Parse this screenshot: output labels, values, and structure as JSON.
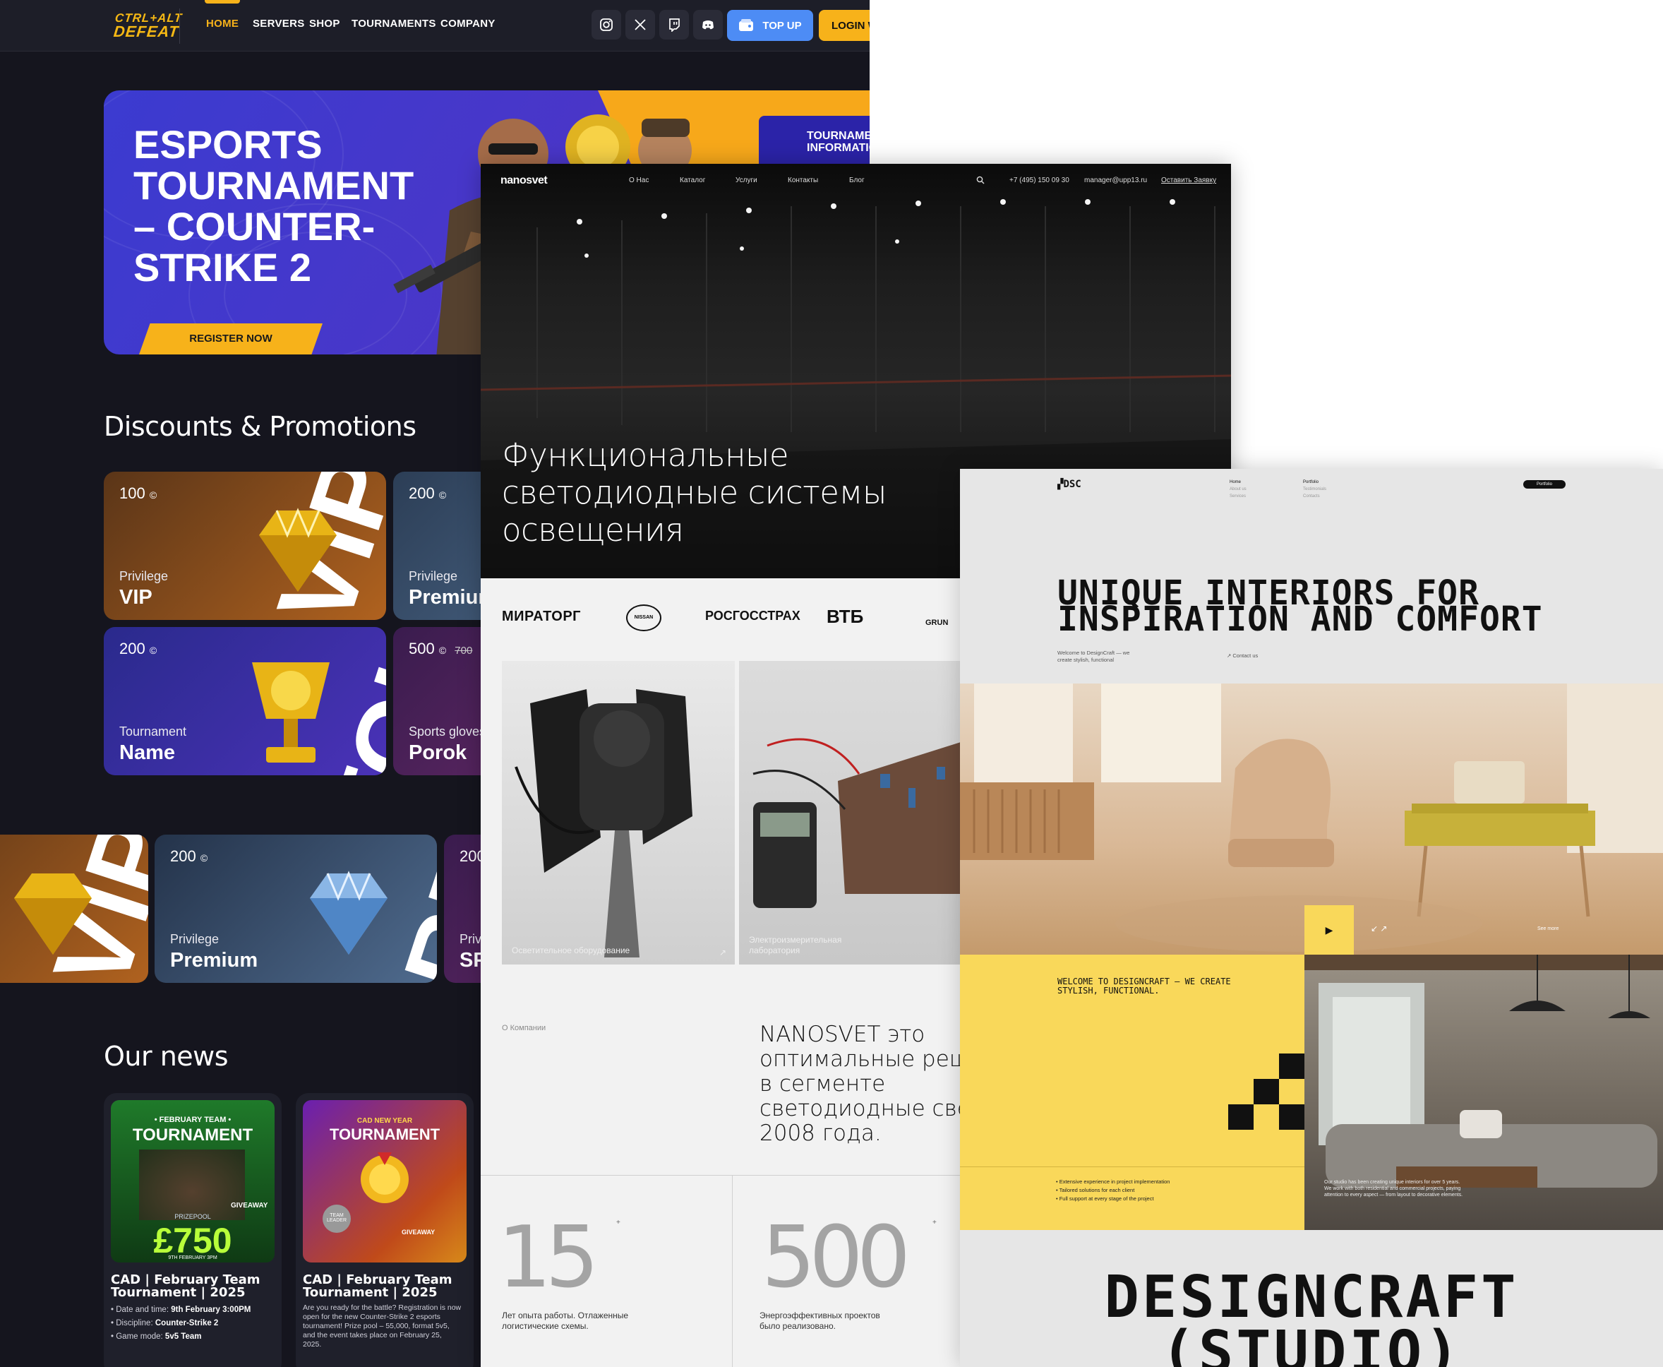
{
  "gaming": {
    "logo": {
      "line1": "CTRL+ALT",
      "line2": "DEFEAT"
    },
    "nav": [
      {
        "label": "HOME",
        "active": true
      },
      {
        "label": "SERVERS"
      },
      {
        "label": "SHOP"
      },
      {
        "label": "TOURNAMENTS"
      },
      {
        "label": "COMPANY"
      }
    ],
    "social_icons": [
      "instagram-icon",
      "x-icon",
      "twitch-icon",
      "discord-icon"
    ],
    "topup_label": "TOP UP",
    "login_label": "LOGIN WITH STEAM",
    "hero": {
      "title": "ESPORTS TOURNAMENT – COUNTER-STRIKE 2",
      "register_label": "REGISTER NOW",
      "info_label": "TOURNAMENT INFORMATION"
    },
    "promos_title": "Discounts & Promotions",
    "promo_cards": [
      {
        "price": "100",
        "kind": "Privilege",
        "name": "VIP",
        "big": "VIP"
      },
      {
        "price": "200",
        "kind": "Privilege",
        "name": "Premium",
        "big": "PREMIUM"
      },
      {
        "price": "200",
        "kind": "Tournament",
        "name": "Name",
        "big": "TOUR"
      },
      {
        "price": "500",
        "old_price": "700",
        "kind": "Sports gloves",
        "name": "Porok",
        "big": "SPORT"
      },
      {
        "price": "",
        "kind": "",
        "name": "",
        "big": "VIP"
      },
      {
        "price": "200",
        "kind": "Privilege",
        "name": "Premium",
        "big": "PREM"
      },
      {
        "price": "200",
        "kind": "Privi",
        "name": "SP",
        "big": ""
      }
    ],
    "currency_symbol": "©",
    "news_title": "Our news",
    "news": [
      {
        "poster_kicker": "• FEBRUARY TEAM •",
        "poster_title": "TOURNAMENT",
        "poster_prize_label": "PRIZEPOOL",
        "poster_prize": "£750",
        "poster_date": "9TH FEBRUARY 3PM",
        "poster_badge": "GIVEAWAY",
        "title": "CAD | February Team Tournament | 2025",
        "meta": [
          {
            "k": "Date and time:",
            "v": "9th February 3:00PM"
          },
          {
            "k": "Discipline:",
            "v": "Counter-Strike 2"
          },
          {
            "k": "Game mode:",
            "v": "5v5 Team"
          }
        ]
      },
      {
        "poster_kicker": "CAD NEW YEAR",
        "poster_title": "TOURNAMENT",
        "poster_badge": "GIVEAWAY",
        "poster_badge2": "TEAM LEADER",
        "title": "CAD | February Team Tournament | 2025",
        "body": "Are you ready for the battle? Registration is now open for the new Counter-Strike 2 esports tournament! Prize pool – 55,000, format 5v5, and the event takes place on February 25, 2025."
      }
    ]
  },
  "nano": {
    "logo": "nanosvet",
    "nav": [
      "О Нас",
      "Каталог",
      "Услуги",
      "Контакты",
      "Блог"
    ],
    "phone": "+7 (495) 150 09 30",
    "email": "manager@upp13.ru",
    "cta": "Оставить Заявку",
    "hero_title": "Функциональные светодиодные системы освещения",
    "client_logos": [
      "МИРАТОРГ",
      "NISSAN",
      "РОСГОССТРАХ",
      "ВТБ",
      "GRUN"
    ],
    "categories": [
      {
        "label": "Осветительное оборудование"
      },
      {
        "label": "Электроизмерительная лаборатория"
      }
    ],
    "about_label": "О Компании",
    "about_text": "NANOSVET это оптимальные решения в сегменте светодиодные свет с 2008 года.",
    "stats": [
      {
        "value": "15",
        "plus": "+",
        "caption": "Лет опыта работы. Отлаженные логистические схемы."
      },
      {
        "value": "500",
        "plus": "+",
        "caption": "Энергоэффективных проектов было реализовано."
      }
    ]
  },
  "designcraft": {
    "logo": "DSC",
    "nav_col1": [
      "Home",
      "About us",
      "Services"
    ],
    "nav_col2": [
      "Portfolio",
      "Testimonials",
      "Contacts"
    ],
    "nav_button": "Portfolio",
    "headline": "UNIQUE INTERIORS FOR INSPIRATION AND COMFORT",
    "intro": "Welcome to DesignCraft — we create stylish, functional",
    "contact_label": "Contact us",
    "see_more": "See more",
    "welcome_heading": "WELCOME TO DESIGNCRAFT — WE CREATE STYLISH, FUNCTIONAL.",
    "bullets": [
      "Extensive experience in project implementation",
      "Tailored solutions for each client",
      "Full support at every stage of the project"
    ],
    "studio_blurb": "Our studio has been creating unique interiors for over 5 years. We work with both residential and commercial projects, paying attention to every aspect — from layout to decorative elements.",
    "big_title": "DESIGNCRAFT",
    "big_subtitle": "(STUDIO)"
  },
  "colors": {
    "accent_yellow": "#f7b21a",
    "topup_blue": "#4d8cf5",
    "dc_yellow": "#f9d85a",
    "dark_bg": "#15151e"
  }
}
